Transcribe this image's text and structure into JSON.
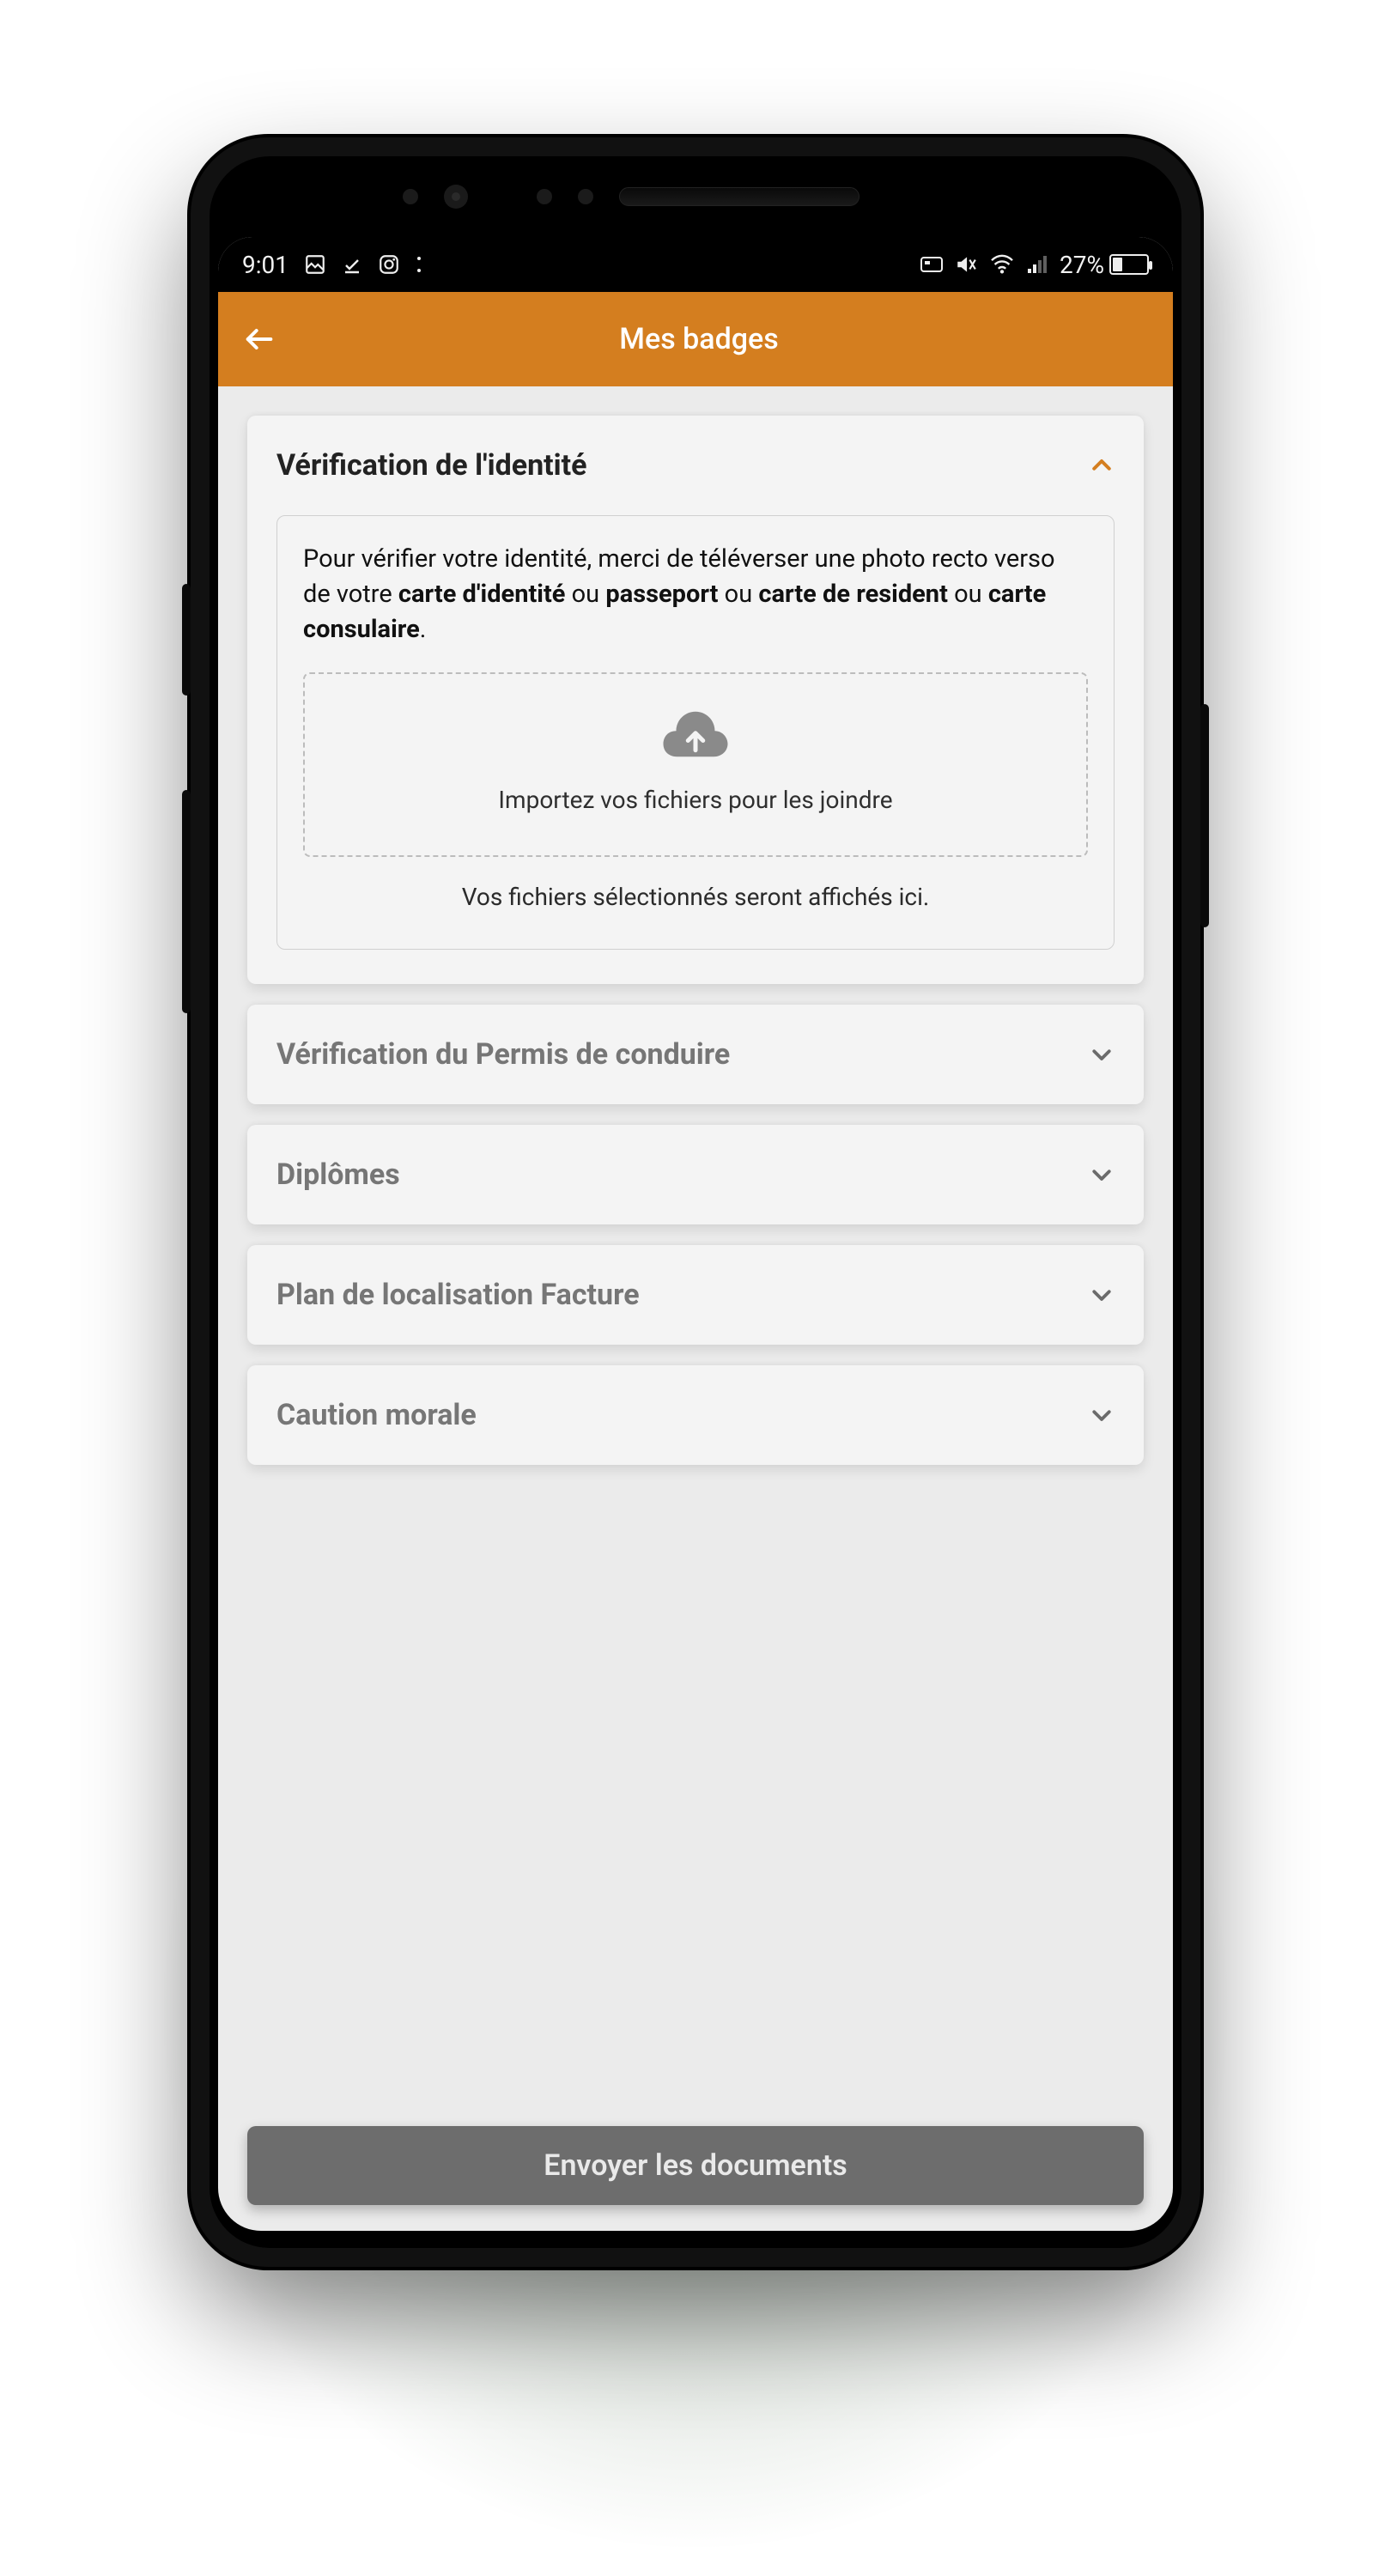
{
  "statusbar": {
    "time": "9:01",
    "battery_pct": "27%"
  },
  "appbar": {
    "title": "Mes badges"
  },
  "sections": {
    "identity": {
      "title": "Vérification de l'identité",
      "info_prefix": "Pour vérifier votre identité, merci de téléverser une photo recto verso de votre ",
      "b1": "carte d'identité",
      "ou1": " ou ",
      "b2": "passeport",
      "ou2": " ou ",
      "b3": "carte de resident",
      "ou3": " ou ",
      "b4": "carte consulaire",
      "period": ".",
      "drop_hint": "Importez vos fichiers pour les joindre",
      "selected_hint": "Vos fichiers sélectionnés seront affichés ici."
    },
    "permis": {
      "title": "Vérification du Permis de conduire"
    },
    "diplomes": {
      "title": "Diplômes"
    },
    "plan": {
      "title": "Plan de localisation Facture"
    },
    "caution": {
      "title": "Caution morale"
    }
  },
  "submit_label": "Envoyer les documents"
}
